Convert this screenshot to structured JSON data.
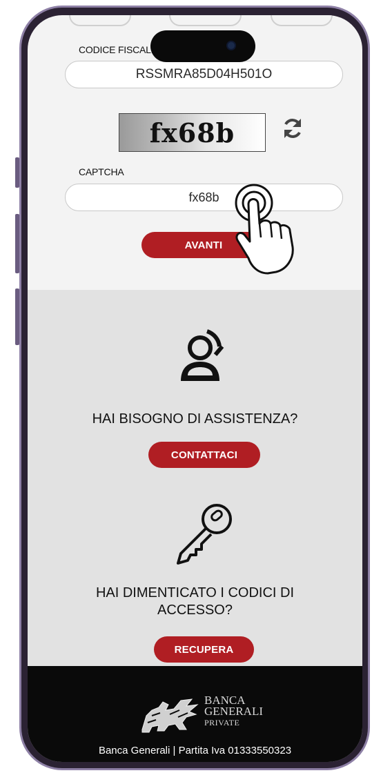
{
  "form": {
    "codice_fiscale_label": "CODICE FISCALE",
    "codice_fiscale_value": "RSSMRA85D04H501O",
    "captcha_image_text": "fx68b",
    "captcha_label": "CAPTCHA",
    "captcha_value": "fx68b",
    "submit_label": "AVANTI"
  },
  "assistance": {
    "icon": "support-agent-icon",
    "heading": "HAI BISOGNO DI ASSISTENZA?",
    "button_label": "CONTATTACI"
  },
  "recovery": {
    "icon": "key-icon",
    "heading_line1": "HAI DIMENTICATO I CODICI DI",
    "heading_line2": "ACCESSO?",
    "button_label": "RECUPERA"
  },
  "footer": {
    "logo_line1": "BANCA",
    "logo_line2": "GENERALI",
    "logo_line3": "PRIVATE",
    "legal_text": "Banca Generali | Partita Iva 01333550323"
  },
  "colors": {
    "accent": "#b01e23",
    "section_bg": "#e2e2e2",
    "footer_bg": "#0a0a0a"
  }
}
